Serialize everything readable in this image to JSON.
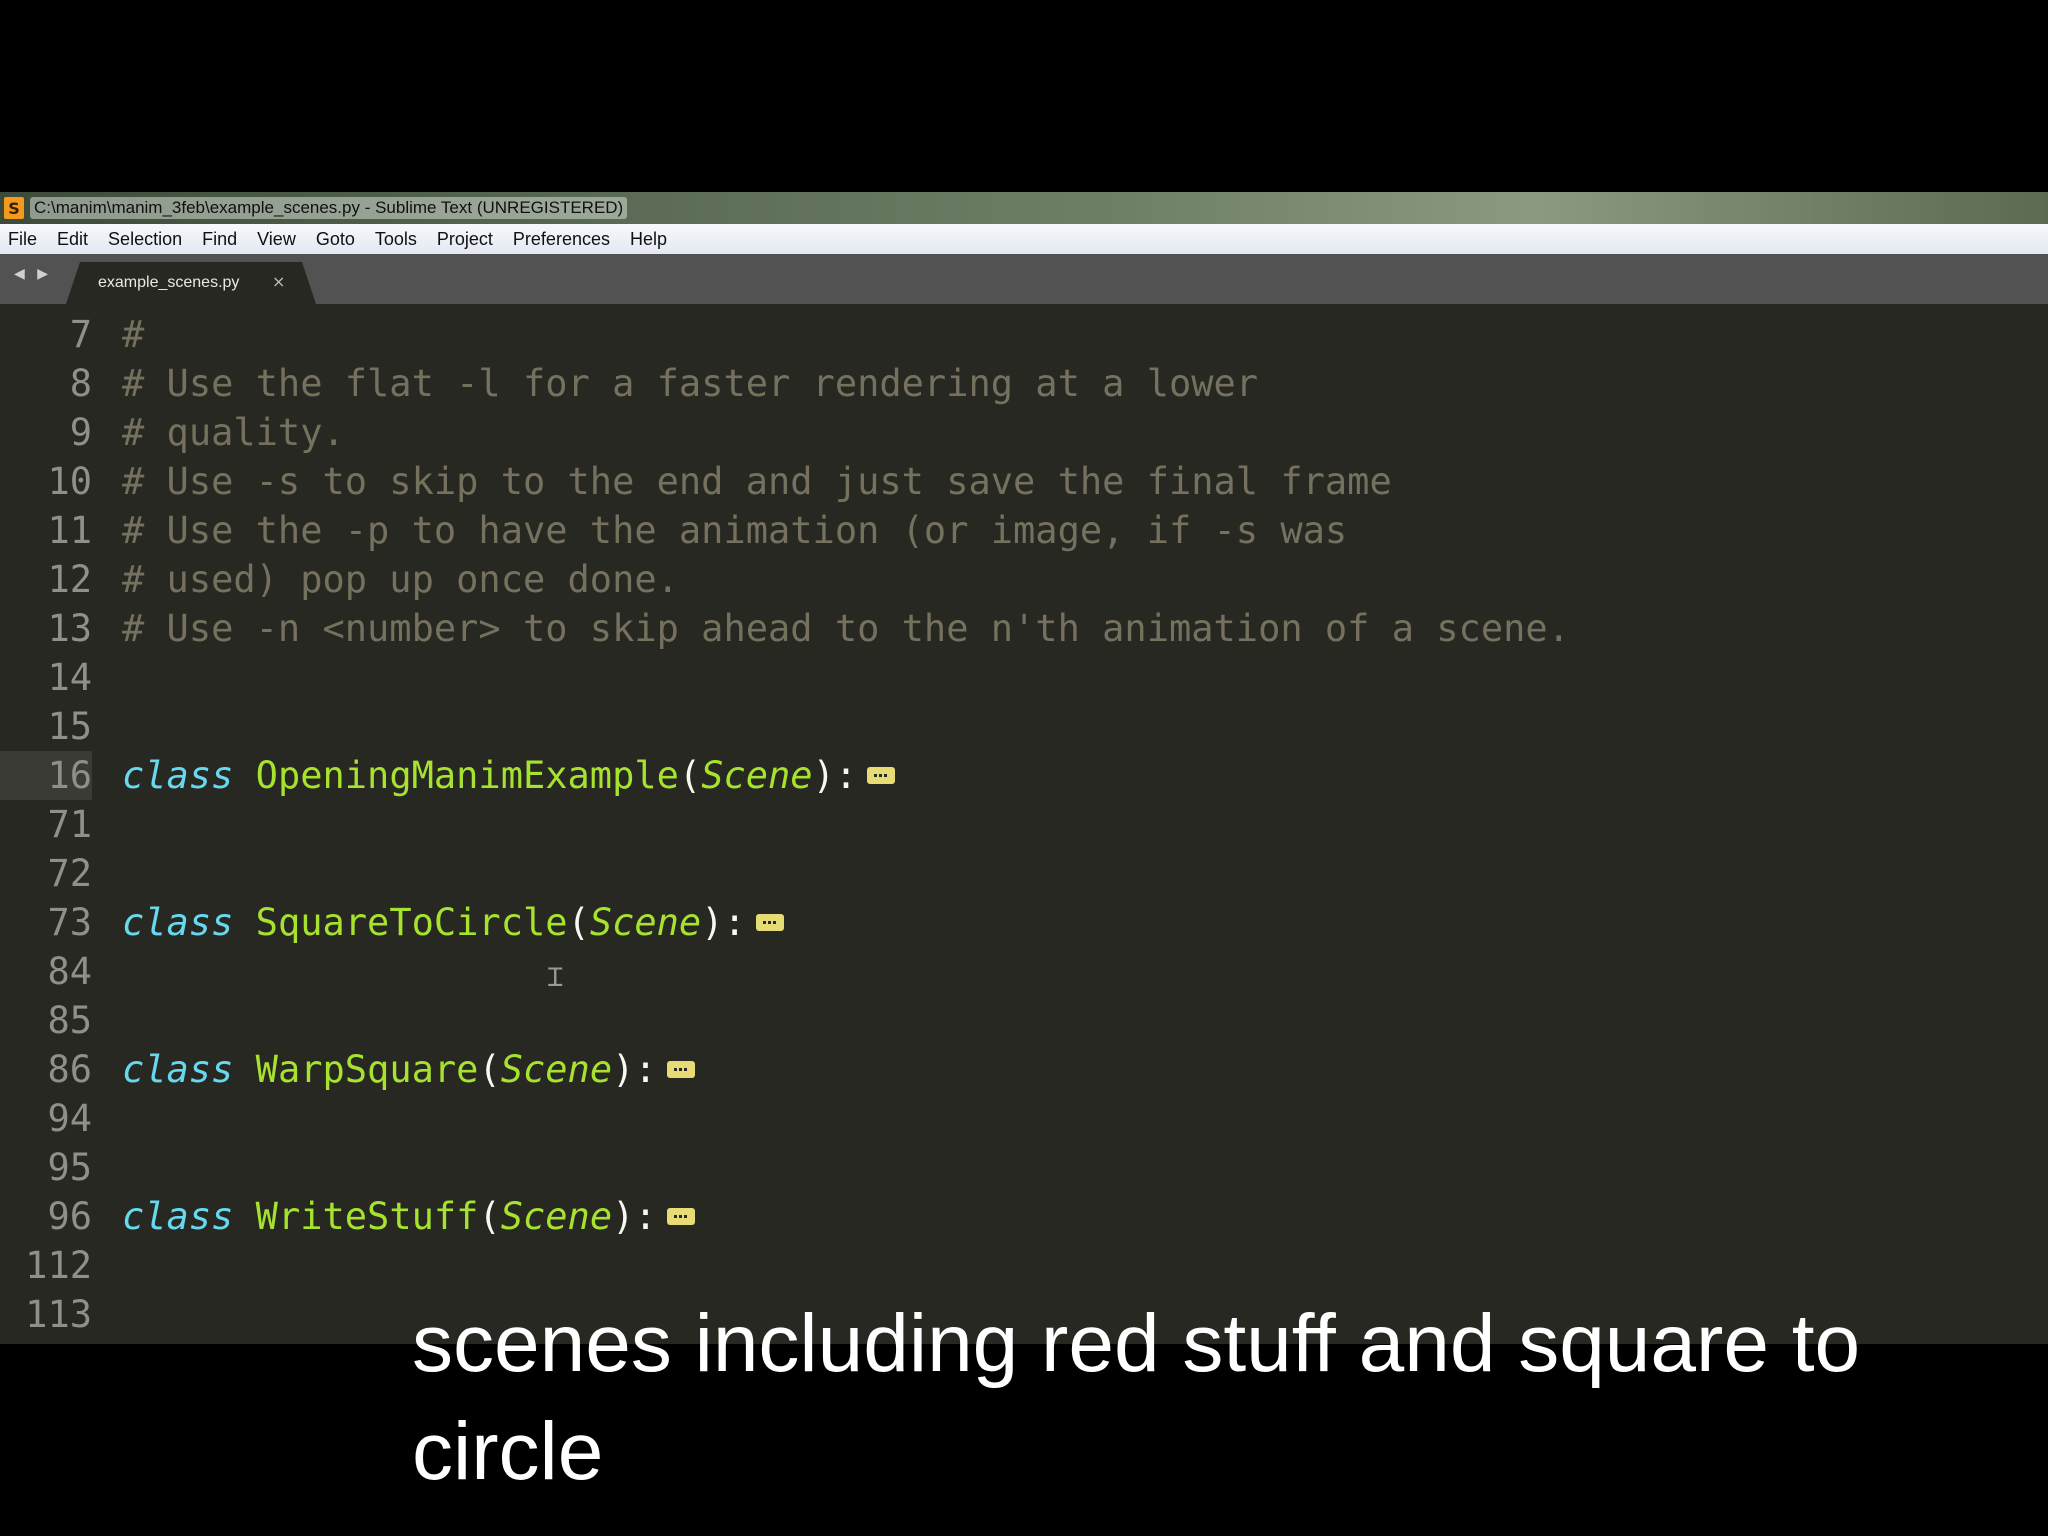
{
  "window": {
    "app_icon": "S",
    "title": "C:\\manim\\manim_3feb\\example_scenes.py - Sublime Text (UNREGISTERED)"
  },
  "menu": [
    "File",
    "Edit",
    "Selection",
    "Find",
    "View",
    "Goto",
    "Tools",
    "Project",
    "Preferences",
    "Help"
  ],
  "tab_bar": {
    "nav_arrows": "◀ ▶",
    "tab_label": "example_scenes.py",
    "tab_close": "×"
  },
  "editor": {
    "active_line": "16",
    "lines": [
      {
        "num": "7",
        "comment": "#"
      },
      {
        "num": "8",
        "comment": "# Use the flat -l for a faster rendering at a lower"
      },
      {
        "num": "9",
        "comment": "# quality."
      },
      {
        "num": "10",
        "comment": "# Use -s to skip to the end and just save the final frame"
      },
      {
        "num": "11",
        "comment": "# Use the -p to have the animation (or image, if -s was"
      },
      {
        "num": "12",
        "comment": "# used) pop up once done."
      },
      {
        "num": "13",
        "comment": "# Use -n <number> to skip ahead to the n'th animation of a scene."
      },
      {
        "num": "14"
      },
      {
        "num": "15"
      },
      {
        "num": "16",
        "keyword": "class",
        "name": "OpeningManimExample",
        "open": "(",
        "base": "Scene",
        "close": "):"
      },
      {
        "num": "71"
      },
      {
        "num": "72"
      },
      {
        "num": "73",
        "keyword": "class",
        "name": "SquareToCircle",
        "open": "(",
        "base": "Scene",
        "close": "):"
      },
      {
        "num": "84"
      },
      {
        "num": "85"
      },
      {
        "num": "86",
        "keyword": "class",
        "name": "WarpSquare",
        "open": "(",
        "base": "Scene",
        "close": "):"
      },
      {
        "num": "94"
      },
      {
        "num": "95"
      },
      {
        "num": "96",
        "keyword": "class",
        "name": "WriteStuff",
        "open": "(",
        "base": "Scene",
        "close": "):"
      },
      {
        "num": "112"
      },
      {
        "num": "113"
      }
    ]
  },
  "caption": {
    "text": "scenes including red stuff and square to circle"
  },
  "icons": {
    "fold_marker": "ellipsis-icon",
    "mouse_cursor": "text-cursor-icon"
  },
  "colors": {
    "editor_bg": "#272822",
    "comment": "#75715e",
    "keyword": "#66d9ef",
    "class_name": "#a6e22e",
    "fold_marker": "#e6db74"
  }
}
